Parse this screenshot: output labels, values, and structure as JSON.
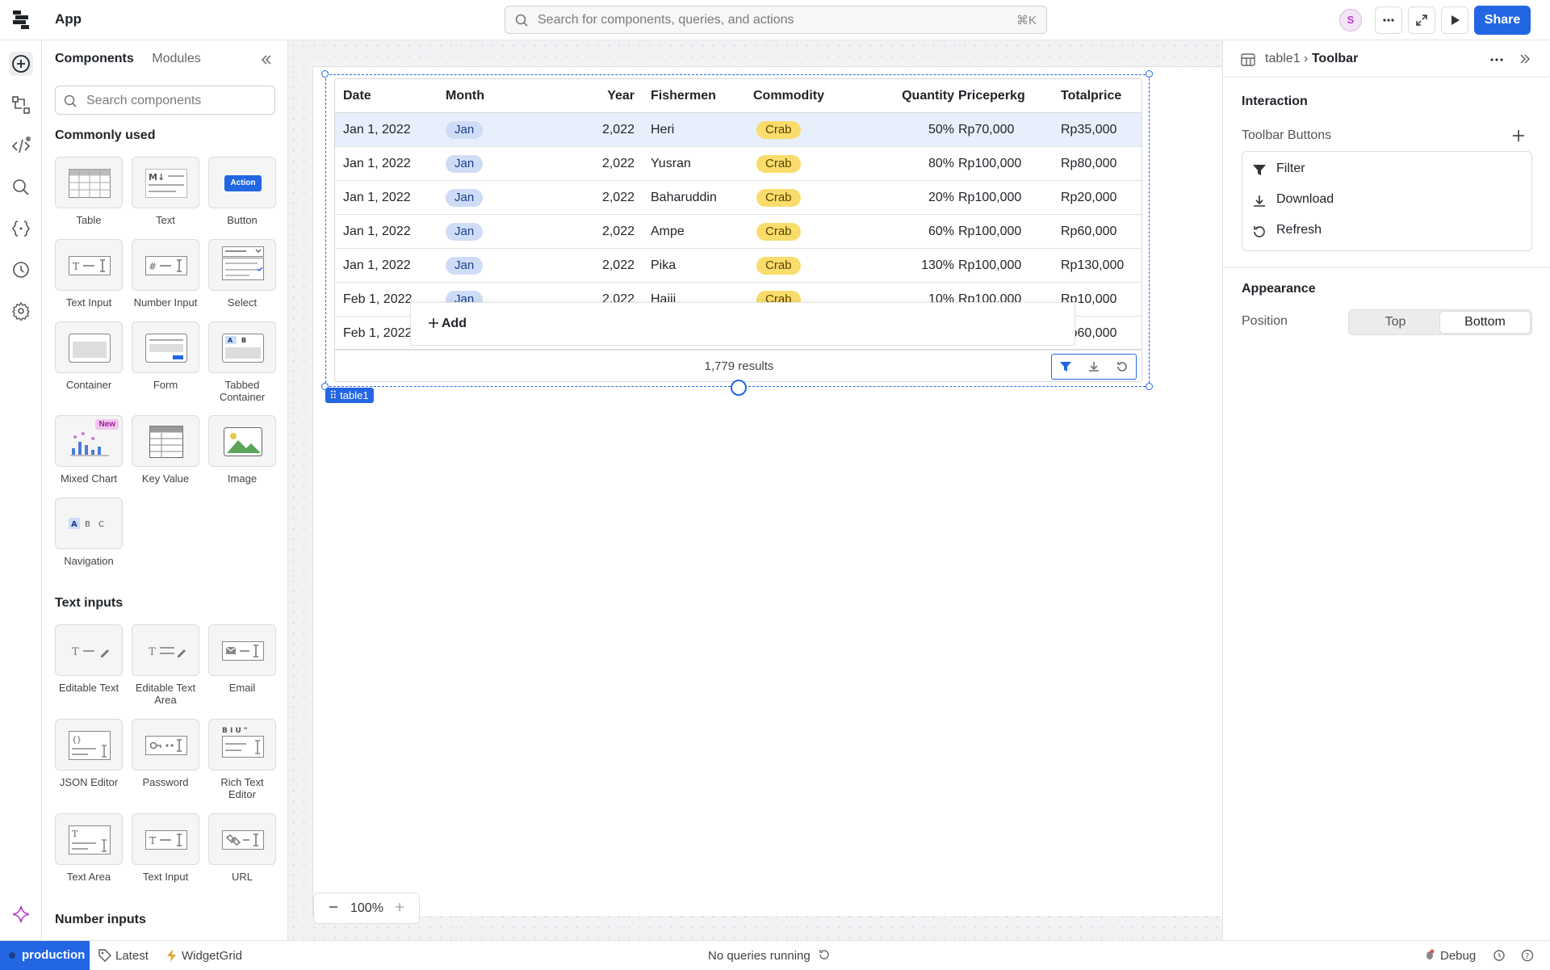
{
  "app": {
    "title": "App"
  },
  "search": {
    "placeholder": "Search for components, queries, and actions",
    "shortcut": "⌘K"
  },
  "user": {
    "initial": "S"
  },
  "share_label": "Share",
  "left_panel": {
    "tabs": [
      "Components",
      "Modules"
    ],
    "search_placeholder": "Search components",
    "sections": {
      "common": "Commonly used",
      "text_inputs": "Text inputs",
      "number_inputs": "Number inputs"
    },
    "common_items": [
      "Table",
      "Text",
      "Button",
      "Text Input",
      "Number Input",
      "Select",
      "Container",
      "Form",
      "Tabbed Container",
      "Mixed Chart",
      "Key Value",
      "Image",
      "Navigation"
    ],
    "text_input_items": [
      "Editable Text",
      "Editable Text Area",
      "Email",
      "JSON Editor",
      "Password",
      "Rich Text Editor",
      "Text Area",
      "Text Input",
      "URL"
    ],
    "badges": {
      "new": "New",
      "action": "Action"
    }
  },
  "table": {
    "columns": [
      "Date",
      "Month",
      "Year",
      "Fishermen",
      "Commodity",
      "Quantity",
      "Priceperkg",
      "Totalprice"
    ],
    "rows": [
      [
        "Jan 1, 2022",
        "Jan",
        "2,022",
        "Heri",
        "Crab",
        "50%",
        "Rp70,000",
        "Rp35,000"
      ],
      [
        "Jan 1, 2022",
        "Jan",
        "2,022",
        "Yusran",
        "Crab",
        "80%",
        "Rp100,000",
        "Rp80,000"
      ],
      [
        "Jan 1, 2022",
        "Jan",
        "2,022",
        "Baharuddin",
        "Crab",
        "20%",
        "Rp100,000",
        "Rp20,000"
      ],
      [
        "Jan 1, 2022",
        "Jan",
        "2,022",
        "Ampe",
        "Crab",
        "60%",
        "Rp100,000",
        "Rp60,000"
      ],
      [
        "Jan 1, 2022",
        "Jan",
        "2,022",
        "Pika",
        "Crab",
        "130%",
        "Rp100,000",
        "Rp130,000"
      ],
      [
        "Feb 1, 2022",
        "Jan",
        "2,022",
        "Hajji",
        "Crab",
        "10%",
        "Rp100,000",
        "Rp10,000"
      ],
      [
        "Feb 1, 2022",
        "",
        "",
        "",
        "",
        "",
        "",
        "Rp60,000"
      ]
    ],
    "add_label": "Add",
    "results": "1,779 results",
    "tag": "table1"
  },
  "zoom": {
    "value": "100%"
  },
  "right_panel": {
    "breadcrumb_parent": "table1",
    "breadcrumb_current": "Toolbar",
    "interaction": "Interaction",
    "toolbar_buttons_label": "Toolbar Buttons",
    "toolbar_buttons": [
      "Filter",
      "Download",
      "Refresh"
    ],
    "appearance": "Appearance",
    "position_label": "Position",
    "position_options": [
      "Top",
      "Bottom"
    ],
    "position_selected": "Bottom"
  },
  "statusbar": {
    "env": "production",
    "version": "Latest",
    "grid": "WidgetGrid",
    "queries": "No queries running",
    "debug": "Debug"
  },
  "colors": {
    "accent": "#2266e3",
    "pill_month": "#cfdcf7",
    "pill_commodity": "#f9dc6b"
  }
}
